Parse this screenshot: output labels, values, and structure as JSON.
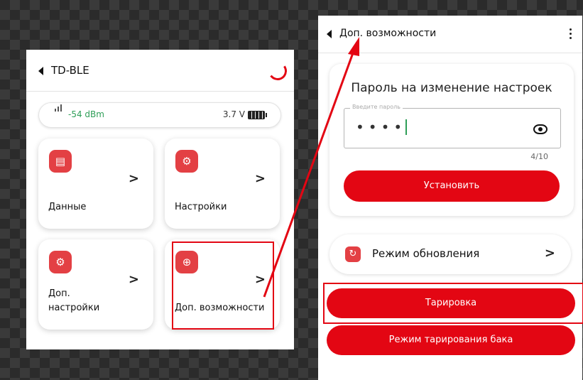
{
  "left_screen": {
    "title": "TD-BLE",
    "status": {
      "signal": "-54 dBm",
      "voltage": "3.7 V"
    },
    "cards": [
      {
        "label": "Данные",
        "icon": "file-icon"
      },
      {
        "label": "Настройки",
        "icon": "gear-icon"
      },
      {
        "label": "Доп.\nнастройки",
        "icon": "gear-plus-icon"
      },
      {
        "label": "Доп. возможности",
        "icon": "plus-circle-icon"
      }
    ],
    "chevron": ">"
  },
  "right_screen": {
    "title": "Доп. возможности",
    "password_card": {
      "title": "Пароль на изменение настроек",
      "field_legend": "Введите пароль",
      "field_value": "••••",
      "counter": "4/10",
      "set_button": "Установить"
    },
    "update_mode": {
      "label": "Режим обновления",
      "icon": "refresh-icon"
    },
    "tare_button": "Тарировка",
    "tank_tare_button": "Режим тарирования бака"
  },
  "colors": {
    "accent": "#e30613",
    "signal": "#2e9e57"
  }
}
